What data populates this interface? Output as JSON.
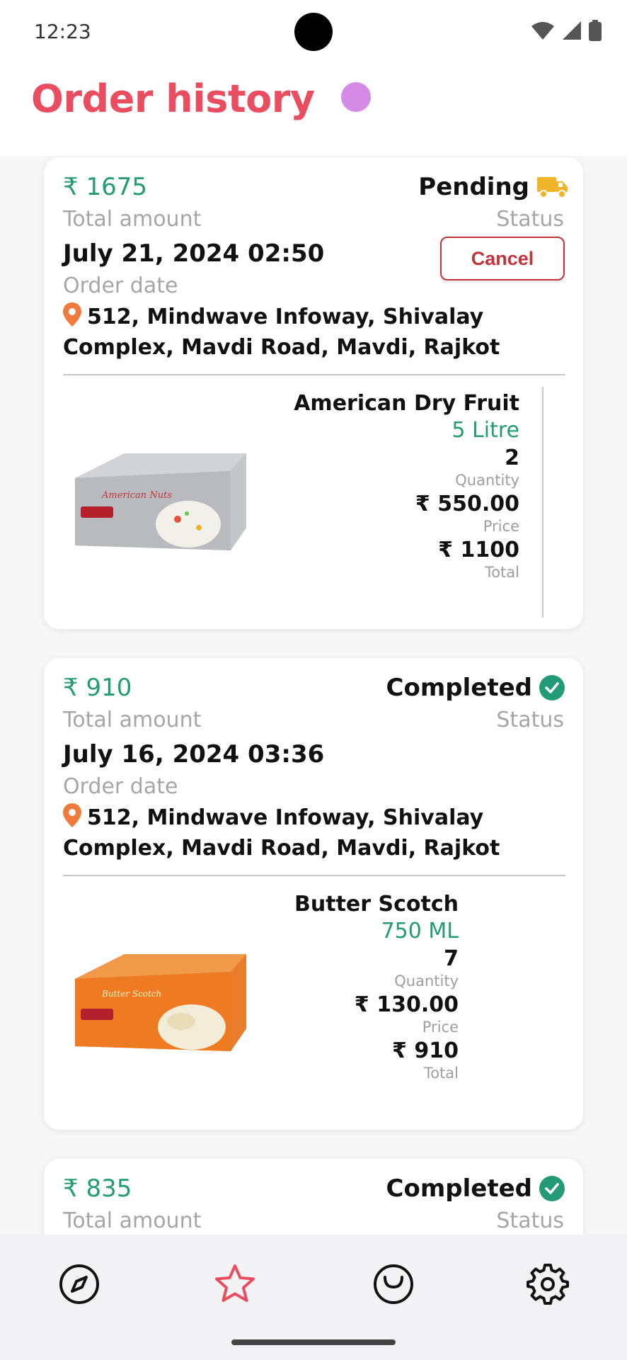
{
  "status_bar": {
    "time": "12:23"
  },
  "header": {
    "title": "Order history"
  },
  "labels": {
    "total_amount": "Total amount",
    "status": "Status",
    "order_date": "Order date",
    "quantity": "Quantity",
    "price": "Price",
    "total": "Total"
  },
  "orders": [
    {
      "amount": "₹ 1675",
      "status": "Pending",
      "date": "July 21, 2024 02:50",
      "cancel_label": "Cancel",
      "address": "512, Mindwave Infoway, Shivalay Complex, Mavdi Road, Mavdi, Rajkot",
      "item": {
        "name": "American Dry Fruit",
        "size": "5 Litre",
        "quantity": "2",
        "price": "₹ 550.00",
        "total": "₹ 1100",
        "box_text": "American Nuts"
      }
    },
    {
      "amount": "₹ 910",
      "status": "Completed",
      "date": "July 16, 2024 03:36",
      "address": "512, Mindwave Infoway, Shivalay Complex, Mavdi Road, Mavdi, Rajkot",
      "item": {
        "name": "Butter Scotch",
        "size": "750 ML",
        "quantity": "7",
        "price": "₹ 130.00",
        "total": "₹ 910",
        "box_text": "Butter Scotch"
      }
    },
    {
      "amount": "₹ 835",
      "status": "Completed"
    }
  ],
  "colors": {
    "accent": "#ea4d60",
    "money": "#239b74",
    "pending": "#f0b429",
    "completed": "#239b74",
    "danger": "#c0343a"
  },
  "nav": [
    "compass-icon",
    "star-icon",
    "clock-icon",
    "gear-icon"
  ]
}
